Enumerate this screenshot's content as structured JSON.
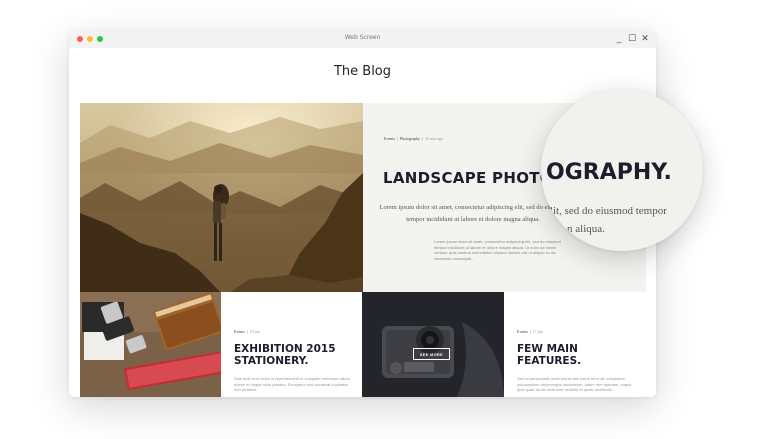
{
  "window": {
    "title": "Web Screen",
    "minimize": "_",
    "maximize": "☐",
    "close": "✕"
  },
  "blog": {
    "title": "The Blog"
  },
  "hero": {
    "meta_cat1": "Events",
    "meta_cat2": "Photography",
    "meta_time": "10 min ago",
    "headline": "LANDSCAPE PHOTOGRAPHY.",
    "lead": "Lorem ipsum dolor sit amet, consectetur adipiscing elit, sed do eiusmod tempor incididunt ut labore et dolore magna aliqua.",
    "body": "Lorem ipsum dolor sit amet, consectetur adipiscing elit, sed do eiusmod tempor incididunt ut labore et dolore magna aliqua. Ut enim ad minim veniam, quis nostrud exercitation ullamco laboris nisi ut aliquip ex ea commodo consequat..."
  },
  "magnifier": {
    "title": "OGRAPHY.",
    "line1": "elit, sed do eiusmod tempor",
    "line2": "n aliqua."
  },
  "cards": [
    {
      "category": "Events",
      "date": "23 jun",
      "title": "EXHIBITION 2015 STATIONERY.",
      "body": "Duis aute irure dolor in reprehenderit in voluptate velit esse cillum dolore eu fugiat nulla pariatur. Excepteur sint occaecat cupidatat non proident."
    },
    {
      "category": "Events",
      "date": "17 jun",
      "title": "FEW MAIN FEATURES.",
      "body": "Sed ut perspiciatis unde omnis iste natus error sit voluptatem accusantium doloremque laudantium, totam rem aperiam, eaque ipsa quae ab illo inventore veritatis et quasi architecto..."
    }
  ],
  "camera_tile": {
    "button": "SEE MORE"
  },
  "colors": {
    "heading": "#1d1d2b",
    "hero_bg": "#f3f3f0",
    "camera_bg": "#2a2b30"
  }
}
